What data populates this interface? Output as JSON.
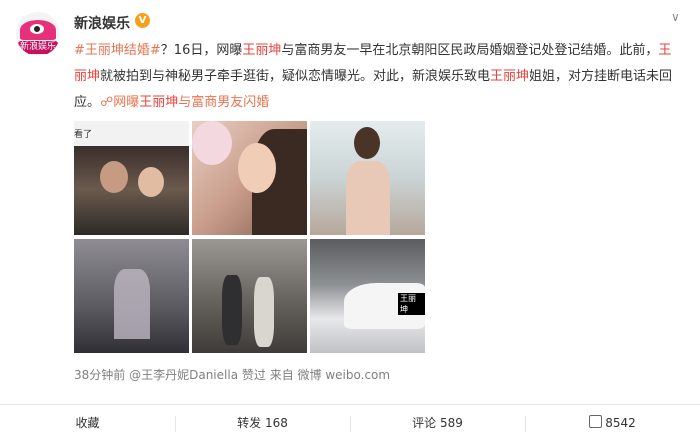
{
  "post": {
    "author": "新浪娱乐",
    "verified_badge": "V",
    "avatar_text": "新浪娱乐",
    "text": {
      "tag": "#王丽坤结婚#",
      "p1": "？16日，网曝",
      "name1": "王丽坤",
      "p2": "与富商男友一早在北京朝阳区民政局婚姻登记处登记结婚。此前，",
      "name2": "王丽坤",
      "p3": "就被拍到与神秘男子牵手逛街，疑似恋情曝光。对此，新浪娱乐致电",
      "name3": "王丽坤",
      "p4": "姐姐，对方挂断电话未回应。",
      "link_pre": "网曝",
      "link_name": "王丽坤",
      "link_post": "与富商男友闪婚"
    },
    "photos": [
      {
        "alt": "photo-1",
        "caption": "看了"
      },
      {
        "alt": "photo-2"
      },
      {
        "alt": "photo-3"
      },
      {
        "alt": "photo-4"
      },
      {
        "alt": "photo-5"
      },
      {
        "alt": "photo-6",
        "caption": "王丽坤"
      }
    ],
    "meta": {
      "time": "38分钟前",
      "liked_by": "@王李丹妮Daniella 赞过",
      "source_prefix": "来自",
      "source": "微博 weibo.com"
    }
  },
  "actions": {
    "favorite": "收藏",
    "repost": "转发 168",
    "comment": "评论 589",
    "like_count": "8542"
  },
  "colors": {
    "tag": "#eb7350",
    "highlight": "#e8413b",
    "verified": "#f7a01b",
    "meta": "#808080"
  }
}
